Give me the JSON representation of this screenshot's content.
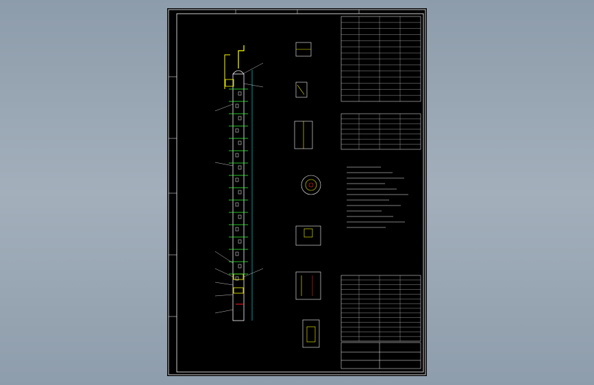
{
  "drawing": {
    "title_block": {
      "project": "",
      "drawing_name": "",
      "drawing_number": ""
    },
    "colors": {
      "background": "#000000",
      "border": "#ffffff",
      "tower_body": "#ffffff",
      "trays": "#3cff3c",
      "nozzles": "#ffff00",
      "dimension": "#00ffff",
      "section": "#ff2020"
    }
  }
}
